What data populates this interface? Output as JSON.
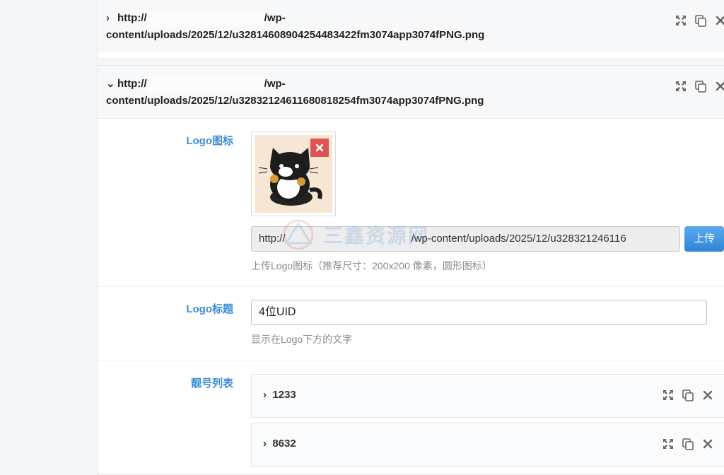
{
  "items": [
    {
      "url_prefix": "http://",
      "url_suffix": "/wp-",
      "url_line2": "content/uploads/2025/12/u3281460890425448342 2fm3074app3074fPNG.png",
      "expanded": false
    },
    {
      "url_prefix": "http://",
      "url_suffix": "/wp-",
      "url_line2": "content/uploads/2025/12/u3283212461168081825 4fm3074app3074fPNG.png",
      "expanded": true
    }
  ],
  "logo_icon": {
    "label": "Logo图标",
    "url_prefix": "http://",
    "url_rest": "/wp-content/uploads/2025/12/u328321246116",
    "upload_label": "上传",
    "hint": "上传Logo图标（推荐尺寸：200x200 像素，圆形图标）"
  },
  "logo_title": {
    "label": "Logo标题",
    "value": "4位UID",
    "hint": "显示在Logo下方的文字"
  },
  "number_list": {
    "label": "靓号列表",
    "items": [
      "1233",
      "8632"
    ]
  },
  "watermark": "三鑫资源网",
  "colors": {
    "label_blue": "#3a8dd8",
    "delete_red": "#de5454",
    "button_blue": "#2f86d6"
  }
}
